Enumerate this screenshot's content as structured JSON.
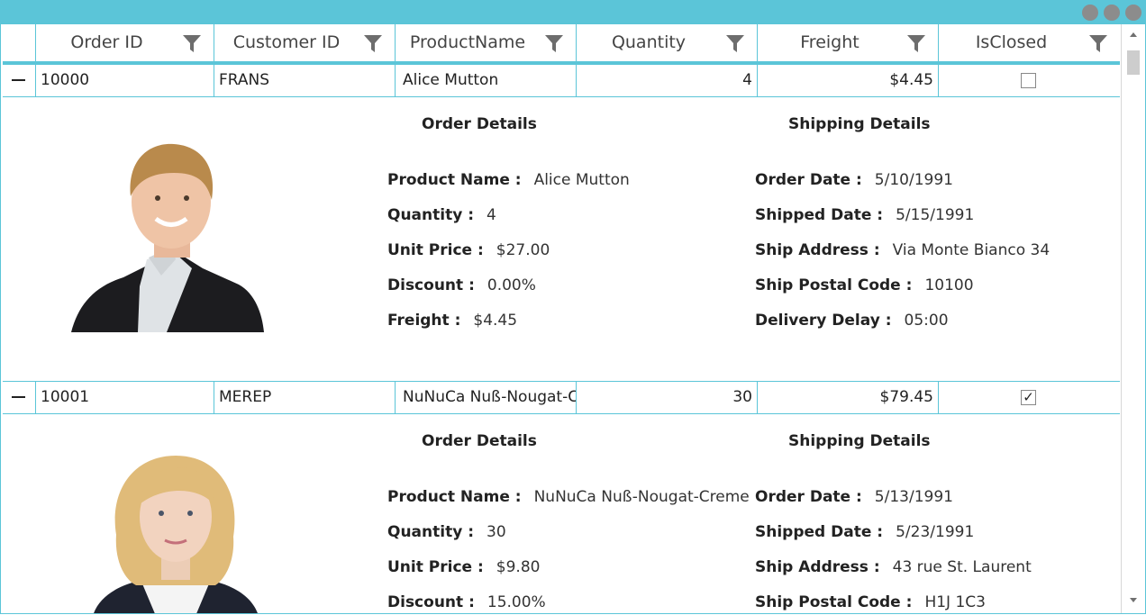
{
  "window": {
    "controls": [
      "window-dot",
      "window-dot",
      "window-dot"
    ]
  },
  "columns": [
    {
      "label": "Order ID"
    },
    {
      "label": "Customer ID"
    },
    {
      "label": "ProductName"
    },
    {
      "label": "Quantity"
    },
    {
      "label": "Freight"
    },
    {
      "label": "IsClosed"
    }
  ],
  "labels": {
    "order_details": "Order Details",
    "shipping_details": "Shipping Details",
    "product_name": "Product Name :",
    "quantity": "Quantity :",
    "unit_price": "Unit Price :",
    "discount": "Discount :",
    "freight": "Freight :",
    "order_date": "Order Date :",
    "shipped_date": "Shipped Date :",
    "ship_address": "Ship Address :",
    "ship_postal_code": "Ship Postal Code :",
    "delivery_delay": "Delivery Delay :"
  },
  "rows": [
    {
      "order_id": "10000",
      "customer_id": "FRANS",
      "product_name": "Alice Mutton",
      "quantity": "4",
      "freight": "$4.45",
      "is_closed": false,
      "detail": {
        "product_name": "Alice Mutton",
        "quantity": "4",
        "unit_price": "$27.00",
        "discount": "0.00%",
        "freight": "$4.45",
        "order_date": "5/10/1991",
        "shipped_date": "5/15/1991",
        "ship_address": "Via Monte Bianco 34",
        "ship_postal_code": "10100",
        "delivery_delay": "05:00"
      }
    },
    {
      "order_id": "10001",
      "customer_id": "MEREP",
      "product_name": "NuNuCa Nuß-Nougat-Creme",
      "quantity": "30",
      "freight": "$79.45",
      "is_closed": true,
      "detail": {
        "product_name": "NuNuCa Nuß-Nougat-Creme",
        "quantity": "30",
        "unit_price": "$9.80",
        "discount": "15.00%",
        "ship_postal_code_value": "H1J 1C3",
        "order_date": "5/13/1991",
        "shipped_date": "5/23/1991",
        "ship_address": "43 rue St. Laurent"
      }
    }
  ],
  "checkmark": "✓",
  "colors": {
    "accent": "#5bc5d8",
    "window_button": "#8c8c8c"
  }
}
